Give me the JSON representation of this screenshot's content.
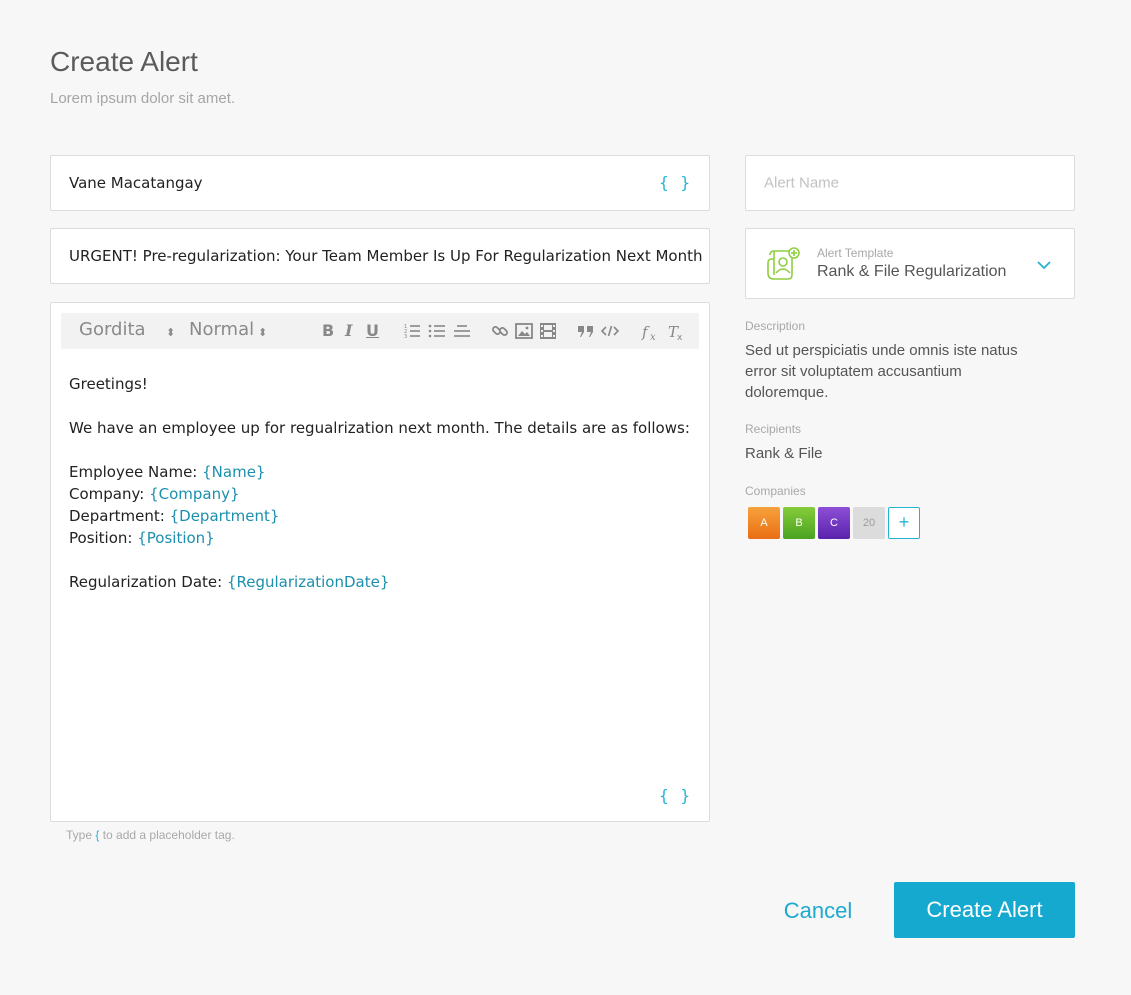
{
  "header": {
    "title": "Create Alert",
    "subtitle": "Lorem ipsum dolor sit amet."
  },
  "form": {
    "sender": "Vane Macatangay",
    "subject": "URGENT! Pre-regularization: Your Team Member Is Up For Regularization Next Month",
    "placeholder_toggle": "{ }",
    "toolbar": {
      "font": "Gordita",
      "size": "Normal",
      "select_arrow": "⬍",
      "bold": "B",
      "italic": "I",
      "underline": "U"
    },
    "body": {
      "greeting": "Greetings!",
      "intro": "We have an employee up for regualrization next month. The details are as follows:",
      "fields": [
        {
          "label": "Employee Name: ",
          "tag": "{Name}"
        },
        {
          "label": "Company: ",
          "tag": "{Company}"
        },
        {
          "label": "Department: ",
          "tag": "{Department}"
        },
        {
          "label": "Position: ",
          "tag": "{Position}"
        }
      ],
      "date_label": "Regularization Date: ",
      "date_tag": "{RegularizationDate}"
    },
    "hint_prefix": "Type ",
    "hint_brace": "{",
    "hint_suffix": " to add a placeholder tag."
  },
  "sidebar": {
    "alert_name_placeholder": "Alert Name",
    "template_label": "Alert Template",
    "template_value": "Rank & File Regularization",
    "description_label": "Description",
    "description_lines": [
      "Sed ut perspiciatis unde omnis iste natus",
      "error sit voluptatem accusantium",
      "doloremque."
    ],
    "recipients_label": "Recipients",
    "recipients_value": "Rank & File",
    "companies_label": "Companies",
    "companies": [
      "A",
      "B",
      "C"
    ],
    "companies_more": "20",
    "add_symbol": "+"
  },
  "actions": {
    "cancel": "Cancel",
    "create": "Create Alert"
  },
  "colors": {
    "accent": "#16a9cf",
    "placeholder_tag": "#1c8fae",
    "background": "#f7f7f7"
  }
}
